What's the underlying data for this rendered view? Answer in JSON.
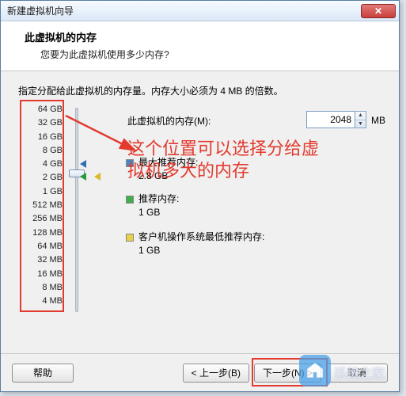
{
  "window": {
    "title": "新建虚拟机向导",
    "close_glyph": "✕"
  },
  "header": {
    "title": "此虚拟机的内存",
    "subtitle": "您要为此虚拟机使用多少内存?"
  },
  "instruction": "指定分配给此虚拟机的内存量。内存大小必须为 4 MB 的倍数。",
  "memory": {
    "label": "此虚拟机的内存(M):",
    "value": "2048",
    "unit": "MB"
  },
  "ticks": [
    "64 GB",
    "32 GB",
    "16 GB",
    "8 GB",
    "4 GB",
    "2 GB",
    "1 GB",
    "512 MB",
    "256 MB",
    "128 MB",
    "64 MB",
    "32 MB",
    "16 MB",
    "8 MB",
    "4 MB"
  ],
  "recs": {
    "max_label": "最大推荐内存:",
    "max_value": "2.8 GB",
    "rec_label": "推荐内存:",
    "rec_value": "1 GB",
    "min_label": "客户机操作系统最低推荐内存:",
    "min_value": "1 GB"
  },
  "annotation": {
    "line1": "这个位置可以选择分给虚",
    "line2": "拟机多大的内存"
  },
  "buttons": {
    "help": "帮助",
    "back": "< 上一步(B)",
    "next": "下一步(N) >",
    "cancel": "取消"
  },
  "colors": {
    "annotation": "#e23a2e",
    "accent": "#4a86c7"
  },
  "watermark": {
    "text": "系统之家"
  }
}
